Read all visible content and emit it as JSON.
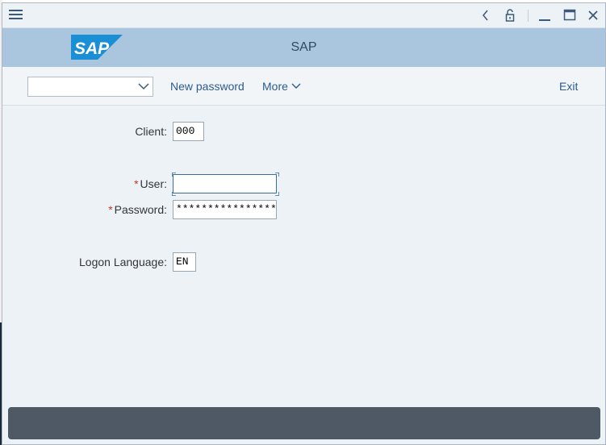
{
  "window": {
    "menu_icon": "hamburger-menu-icon",
    "controls": [
      "back-icon",
      "lock-icon",
      "minimize-icon",
      "maximize-icon",
      "close-icon"
    ]
  },
  "header": {
    "logo_text": "SAP",
    "title": "SAP",
    "colors": {
      "header_bg": "#a9c6de",
      "logo_blue": "#1b8fd6"
    }
  },
  "toolbar": {
    "select_value": "",
    "new_password_label": "New password",
    "more_label": "More",
    "exit_label": "Exit"
  },
  "form": {
    "client_label": "Client:",
    "client_value": "000",
    "user_label": "User:",
    "user_value": "",
    "password_label": "Password:",
    "password_value": "****************",
    "required_marker": "*",
    "language_label": "Logon Language:",
    "language_value": "EN"
  },
  "status": {
    "text": "",
    "color": "#4e5965"
  }
}
